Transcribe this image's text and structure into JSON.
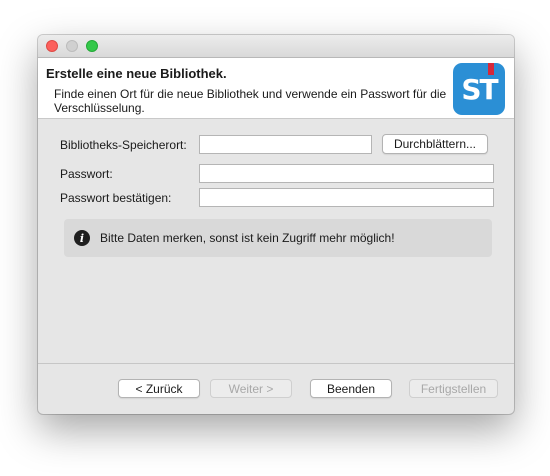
{
  "window": {
    "controls": [
      "close",
      "minimize",
      "maximize"
    ]
  },
  "header": {
    "title": "Erstelle eine neue Bibliothek.",
    "description": "Finde einen Ort für die neue Bibliothek und verwende ein Passwort für die Verschlüsselung.",
    "logo_text": "ST",
    "logo_color": "#2b8fd5"
  },
  "form": {
    "location_label": "Bibliotheks-Speicherort:",
    "location_value": "",
    "browse_label": "Durchblättern...",
    "password_label": "Passwort:",
    "password_value": "",
    "confirm_label": "Passwort bestätigen:",
    "confirm_value": ""
  },
  "info": {
    "icon": "info-icon",
    "text": "Bitte Daten merken, sonst ist kein Zugriff mehr möglich!"
  },
  "footer": {
    "back_label": "< Zurück",
    "next_label": "Weiter >",
    "cancel_label": "Beenden",
    "finish_label": "Fertigstellen"
  }
}
